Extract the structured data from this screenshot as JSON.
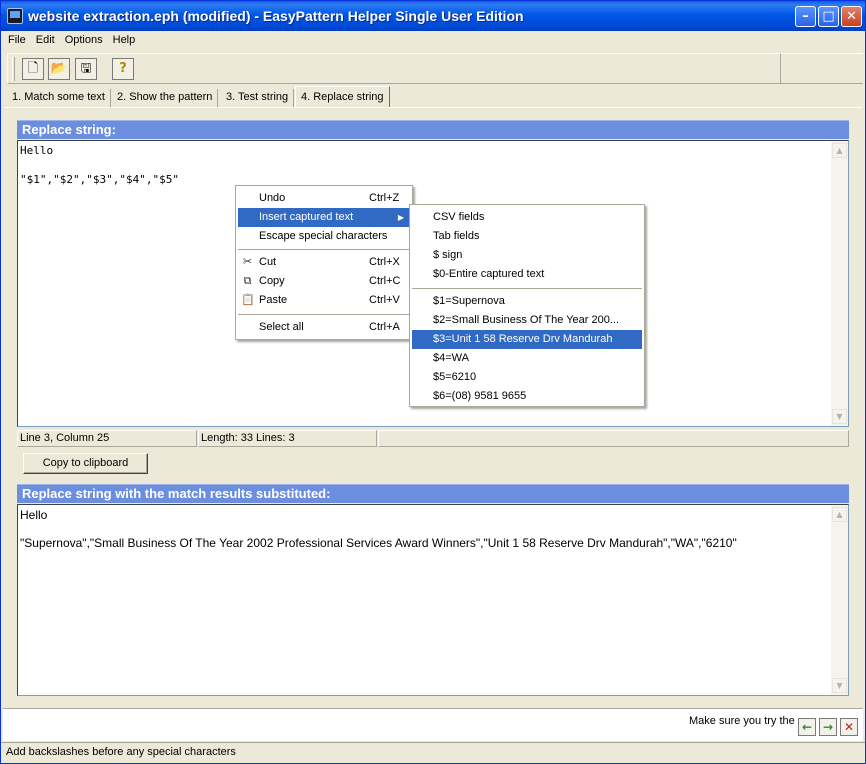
{
  "window": {
    "title": "website extraction.eph (modified) - EasyPattern Helper Single User Edition"
  },
  "menubar": [
    "File",
    "Edit",
    "Options",
    "Help"
  ],
  "tabs": [
    "1. Match some text",
    "2. Show the pattern",
    "3. Test string",
    "4. Replace string"
  ],
  "replace_section": {
    "header": "Replace string:",
    "line1": "Hello",
    "line3": "\"$1\",\"$2\",\"$3\",\"$4\",\"$5\""
  },
  "status": {
    "position": "Line 3, Column 25",
    "length": "Length: 33  Lines: 3"
  },
  "copy_button": "Copy to clipboard",
  "result_section": {
    "header": "Replace string with the match results substituted:",
    "line1": "Hello",
    "line3": "\"Supernova\",\"Small Business Of The Year 2002 Professional Services Award Winners\",\"Unit 1 58 Reserve Drv Mandurah\",\"WA\",\"6210\""
  },
  "footer": {
    "hint": "Make sure you try the",
    "statusbar": "Add backslashes before any special characters"
  },
  "context_menu": {
    "undo": {
      "label": "Undo",
      "shortcut": "Ctrl+Z"
    },
    "insert_captured": "Insert captured text",
    "escape_special": "Escape special characters",
    "cut": {
      "label": "Cut",
      "shortcut": "Ctrl+X"
    },
    "copy": {
      "label": "Copy",
      "shortcut": "Ctrl+C"
    },
    "paste": {
      "label": "Paste",
      "shortcut": "Ctrl+V"
    },
    "select_all": {
      "label": "Select all",
      "shortcut": "Ctrl+A"
    }
  },
  "submenu": {
    "csv_fields": "CSV fields",
    "tab_fields": "Tab fields",
    "dollar_sign": "$ sign",
    "entire": "$0-Entire captured text",
    "captures": [
      "$1=Supernova",
      "$2=Small Business Of The Year 200...",
      "$3=Unit 1 58 Reserve Drv Mandurah",
      "$4=WA",
      "$5=6210",
      "$6=(08) 9581 9655"
    ]
  },
  "colors": {
    "title_bar": "#0058e6",
    "group_header": "#6c8ede",
    "menu_highlight": "#316ac5",
    "window_bg": "#ece9d8"
  }
}
